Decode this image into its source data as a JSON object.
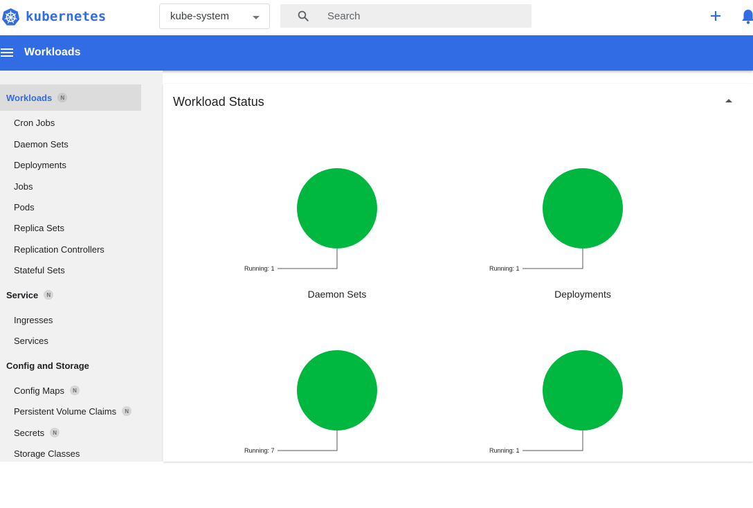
{
  "topbar": {
    "brand": "kubernetes",
    "brand_color": "#326ce5",
    "namespace": "kube-system",
    "search_placeholder": "Search",
    "add_icon": "plus-icon",
    "notifications_icon": "bell-icon"
  },
  "appbar": {
    "title": "Workloads",
    "color": "#326ce5"
  },
  "sidebar": {
    "sections": [
      {
        "label": "Workloads",
        "badge": "N",
        "active": true,
        "items": [
          "Cron Jobs",
          "Daemon Sets",
          "Deployments",
          "Jobs",
          "Pods",
          "Replica Sets",
          "Replication Controllers",
          "Stateful Sets"
        ]
      },
      {
        "label": "Service",
        "badge": "N",
        "items": [
          "Ingresses",
          "Services"
        ]
      },
      {
        "label": "Config and Storage",
        "items": [
          {
            "label": "Config Maps",
            "badge": "N"
          },
          {
            "label": "Persistent Volume Claims",
            "badge": "N"
          },
          {
            "label": "Secrets",
            "badge": "N"
          },
          {
            "label": "Storage Classes"
          }
        ]
      }
    ]
  },
  "main": {
    "card_title": "Workload Status",
    "status_color": "#00b83f",
    "charts": [
      {
        "name": "Daemon Sets",
        "running_label": "Running: 1",
        "running": 1
      },
      {
        "name": "Deployments",
        "running_label": "Running: 1",
        "running": 1
      },
      {
        "name": "",
        "running_label": "Running: 7",
        "running": 7
      },
      {
        "name": "",
        "running_label": "Running: 1",
        "running": 1
      }
    ]
  }
}
